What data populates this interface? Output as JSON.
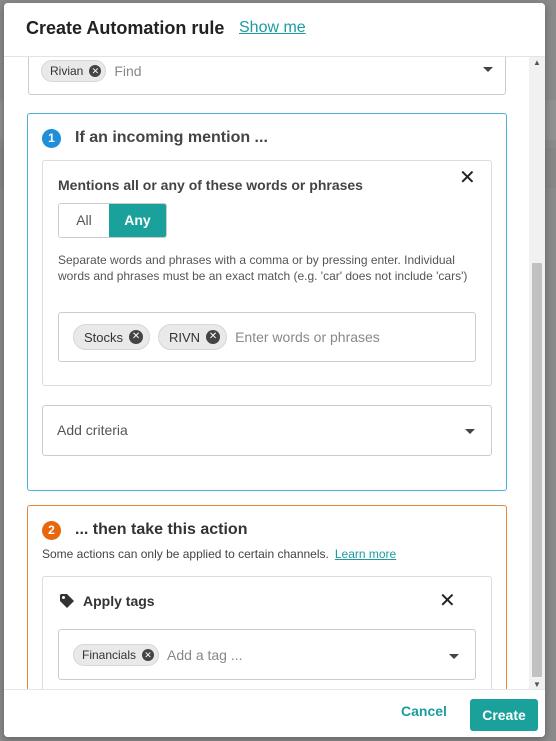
{
  "modal": {
    "title": "Create Automation rule",
    "show_me": "Show me"
  },
  "top_field": {
    "chips": [
      "Rivian"
    ],
    "placeholder": "Find"
  },
  "step1": {
    "number": "1",
    "title": "If an incoming mention ...",
    "criteria": {
      "label": "Mentions all or any of these words or phrases",
      "toggle": {
        "options": [
          "All",
          "Any"
        ],
        "selected": "Any"
      },
      "help_text": "Separate words and phrases with a comma or by pressing enter. Individual words and phrases must be an exact match (e.g. 'car' does not include 'cars')",
      "words": [
        "Stocks",
        "RIVN"
      ],
      "placeholder": "Enter words or phrases"
    },
    "add_criteria": "Add criteria"
  },
  "step2": {
    "number": "2",
    "title": "... then take this action",
    "subtitle": "Some actions can only be applied to certain channels.",
    "learn_more": "Learn more",
    "action": {
      "label": "Apply tags",
      "tags": [
        "Financials"
      ],
      "placeholder": "Add a tag ..."
    }
  },
  "footer": {
    "cancel": "Cancel",
    "create": "Create"
  },
  "colors": {
    "accent": "#1aa19b",
    "link": "#1a9ca0",
    "step1": "#1e8fd8",
    "step2": "#e8660c"
  },
  "icons": {
    "chip_remove": "close-circle-icon",
    "close": "close-icon",
    "dropdown": "caret-down-icon",
    "tag": "tag-icon"
  }
}
